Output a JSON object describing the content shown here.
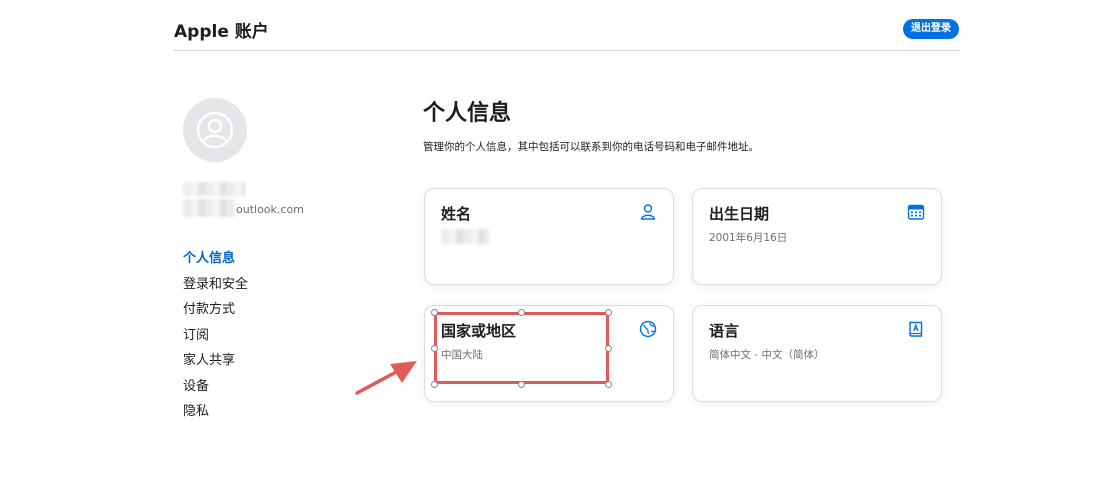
{
  "header": {
    "brand": "Apple 账户",
    "signout_label": "退出登录"
  },
  "profile": {
    "email_suffix": "outlook.com"
  },
  "sidebar": {
    "items": [
      {
        "label": "个人信息",
        "active": true
      },
      {
        "label": "登录和安全"
      },
      {
        "label": "付款方式"
      },
      {
        "label": "订阅"
      },
      {
        "label": "家人共享"
      },
      {
        "label": "设备"
      },
      {
        "label": "隐私"
      }
    ]
  },
  "main": {
    "title": "个人信息",
    "description": "管理你的个人信息，其中包括可以联系到你的电话号码和电子邮件地址。",
    "cards": [
      {
        "title": "姓名",
        "value": "",
        "icon": "person-icon"
      },
      {
        "title": "出生日期",
        "value": "2001年6月16日",
        "icon": "calendar-icon"
      },
      {
        "title": "国家或地区",
        "value": "中国大陆",
        "icon": "globe-icon"
      },
      {
        "title": "语言",
        "value": "简体中文 - 中文（简体）",
        "icon": "book-icon"
      }
    ]
  },
  "colors": {
    "accent": "#0071e3",
    "link": "#0066cc",
    "annotation": "#e05a5a"
  }
}
